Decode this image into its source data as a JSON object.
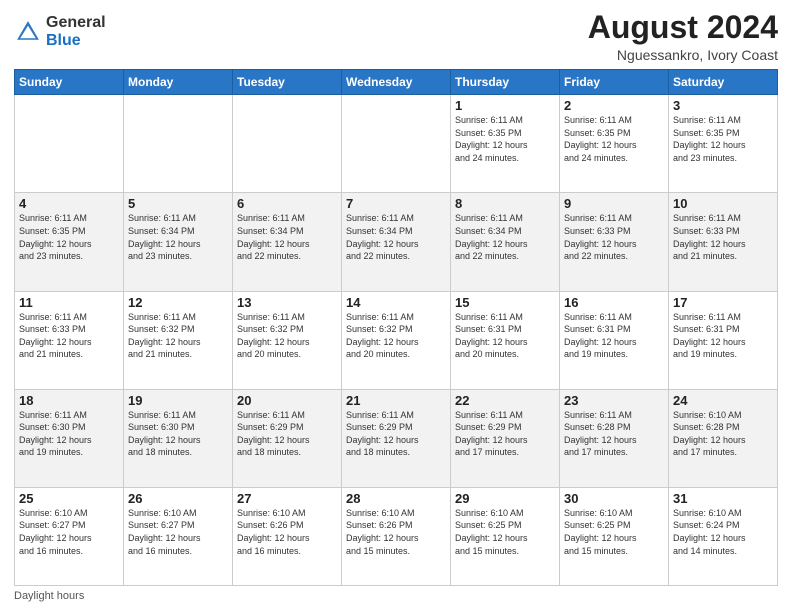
{
  "header": {
    "logo_general": "General",
    "logo_blue": "Blue",
    "title": "August 2024",
    "subtitle": "Nguessankro, Ivory Coast"
  },
  "weekdays": [
    "Sunday",
    "Monday",
    "Tuesday",
    "Wednesday",
    "Thursday",
    "Friday",
    "Saturday"
  ],
  "footer_label": "Daylight hours",
  "weeks": [
    [
      {
        "day": "",
        "info": ""
      },
      {
        "day": "",
        "info": ""
      },
      {
        "day": "",
        "info": ""
      },
      {
        "day": "",
        "info": ""
      },
      {
        "day": "1",
        "info": "Sunrise: 6:11 AM\nSunset: 6:35 PM\nDaylight: 12 hours\nand 24 minutes."
      },
      {
        "day": "2",
        "info": "Sunrise: 6:11 AM\nSunset: 6:35 PM\nDaylight: 12 hours\nand 24 minutes."
      },
      {
        "day": "3",
        "info": "Sunrise: 6:11 AM\nSunset: 6:35 PM\nDaylight: 12 hours\nand 23 minutes."
      }
    ],
    [
      {
        "day": "4",
        "info": "Sunrise: 6:11 AM\nSunset: 6:35 PM\nDaylight: 12 hours\nand 23 minutes."
      },
      {
        "day": "5",
        "info": "Sunrise: 6:11 AM\nSunset: 6:34 PM\nDaylight: 12 hours\nand 23 minutes."
      },
      {
        "day": "6",
        "info": "Sunrise: 6:11 AM\nSunset: 6:34 PM\nDaylight: 12 hours\nand 22 minutes."
      },
      {
        "day": "7",
        "info": "Sunrise: 6:11 AM\nSunset: 6:34 PM\nDaylight: 12 hours\nand 22 minutes."
      },
      {
        "day": "8",
        "info": "Sunrise: 6:11 AM\nSunset: 6:34 PM\nDaylight: 12 hours\nand 22 minutes."
      },
      {
        "day": "9",
        "info": "Sunrise: 6:11 AM\nSunset: 6:33 PM\nDaylight: 12 hours\nand 22 minutes."
      },
      {
        "day": "10",
        "info": "Sunrise: 6:11 AM\nSunset: 6:33 PM\nDaylight: 12 hours\nand 21 minutes."
      }
    ],
    [
      {
        "day": "11",
        "info": "Sunrise: 6:11 AM\nSunset: 6:33 PM\nDaylight: 12 hours\nand 21 minutes."
      },
      {
        "day": "12",
        "info": "Sunrise: 6:11 AM\nSunset: 6:32 PM\nDaylight: 12 hours\nand 21 minutes."
      },
      {
        "day": "13",
        "info": "Sunrise: 6:11 AM\nSunset: 6:32 PM\nDaylight: 12 hours\nand 20 minutes."
      },
      {
        "day": "14",
        "info": "Sunrise: 6:11 AM\nSunset: 6:32 PM\nDaylight: 12 hours\nand 20 minutes."
      },
      {
        "day": "15",
        "info": "Sunrise: 6:11 AM\nSunset: 6:31 PM\nDaylight: 12 hours\nand 20 minutes."
      },
      {
        "day": "16",
        "info": "Sunrise: 6:11 AM\nSunset: 6:31 PM\nDaylight: 12 hours\nand 19 minutes."
      },
      {
        "day": "17",
        "info": "Sunrise: 6:11 AM\nSunset: 6:31 PM\nDaylight: 12 hours\nand 19 minutes."
      }
    ],
    [
      {
        "day": "18",
        "info": "Sunrise: 6:11 AM\nSunset: 6:30 PM\nDaylight: 12 hours\nand 19 minutes."
      },
      {
        "day": "19",
        "info": "Sunrise: 6:11 AM\nSunset: 6:30 PM\nDaylight: 12 hours\nand 18 minutes."
      },
      {
        "day": "20",
        "info": "Sunrise: 6:11 AM\nSunset: 6:29 PM\nDaylight: 12 hours\nand 18 minutes."
      },
      {
        "day": "21",
        "info": "Sunrise: 6:11 AM\nSunset: 6:29 PM\nDaylight: 12 hours\nand 18 minutes."
      },
      {
        "day": "22",
        "info": "Sunrise: 6:11 AM\nSunset: 6:29 PM\nDaylight: 12 hours\nand 17 minutes."
      },
      {
        "day": "23",
        "info": "Sunrise: 6:11 AM\nSunset: 6:28 PM\nDaylight: 12 hours\nand 17 minutes."
      },
      {
        "day": "24",
        "info": "Sunrise: 6:10 AM\nSunset: 6:28 PM\nDaylight: 12 hours\nand 17 minutes."
      }
    ],
    [
      {
        "day": "25",
        "info": "Sunrise: 6:10 AM\nSunset: 6:27 PM\nDaylight: 12 hours\nand 16 minutes."
      },
      {
        "day": "26",
        "info": "Sunrise: 6:10 AM\nSunset: 6:27 PM\nDaylight: 12 hours\nand 16 minutes."
      },
      {
        "day": "27",
        "info": "Sunrise: 6:10 AM\nSunset: 6:26 PM\nDaylight: 12 hours\nand 16 minutes."
      },
      {
        "day": "28",
        "info": "Sunrise: 6:10 AM\nSunset: 6:26 PM\nDaylight: 12 hours\nand 15 minutes."
      },
      {
        "day": "29",
        "info": "Sunrise: 6:10 AM\nSunset: 6:25 PM\nDaylight: 12 hours\nand 15 minutes."
      },
      {
        "day": "30",
        "info": "Sunrise: 6:10 AM\nSunset: 6:25 PM\nDaylight: 12 hours\nand 15 minutes."
      },
      {
        "day": "31",
        "info": "Sunrise: 6:10 AM\nSunset: 6:24 PM\nDaylight: 12 hours\nand 14 minutes."
      }
    ]
  ]
}
